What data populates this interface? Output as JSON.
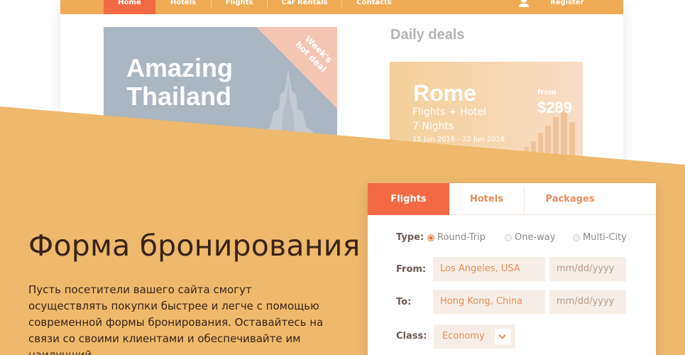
{
  "mockup": {
    "nav": {
      "items": [
        "Home",
        "Hotels",
        "Flights",
        "Car Rentals",
        "Contacts"
      ],
      "active": "Home",
      "register": "Register"
    },
    "featured": {
      "title_line1": "Amazing",
      "title_line2": "Thailand",
      "ribbon_line1": "Week's",
      "ribbon_line2": "hot deal"
    },
    "deals": {
      "heading": "Daily deals",
      "city": "Rome",
      "package": "Flights + Hotel",
      "nights": "7 Nights",
      "dates": "15 Jun 2016 - 22 Jun 2016",
      "from_label": "from",
      "price": "$289"
    }
  },
  "hero": {
    "title": "Форма бронирования",
    "description": "Пусть посетители вашего сайта смогут осуществлять покупки быстрее и легче с помощью современной формы бронирования. Оставайтесь на связи со своими клиентами и обеспечивайте им наилучший"
  },
  "booking": {
    "tabs": [
      "Flights",
      "Hotels",
      "Packages"
    ],
    "active_tab": "Flights",
    "type_label": "Type:",
    "trip_types": [
      "Round-Trip",
      "One-way",
      "Multi-City"
    ],
    "selected_trip": "Round-Trip",
    "from_label": "From:",
    "from_value": "Los Angeles, USA",
    "from_date_placeholder": "mm/dd/yyyy",
    "to_label": "To:",
    "to_value": "Hong Kong, China",
    "to_date_placeholder": "mm/dd/yyyy",
    "class_label": "Class:",
    "class_value": "Economy"
  },
  "colors": {
    "accent": "#f26a44",
    "band": "#eeb96c",
    "nav": "#eeaa54",
    "heading_text": "#3a2317"
  }
}
